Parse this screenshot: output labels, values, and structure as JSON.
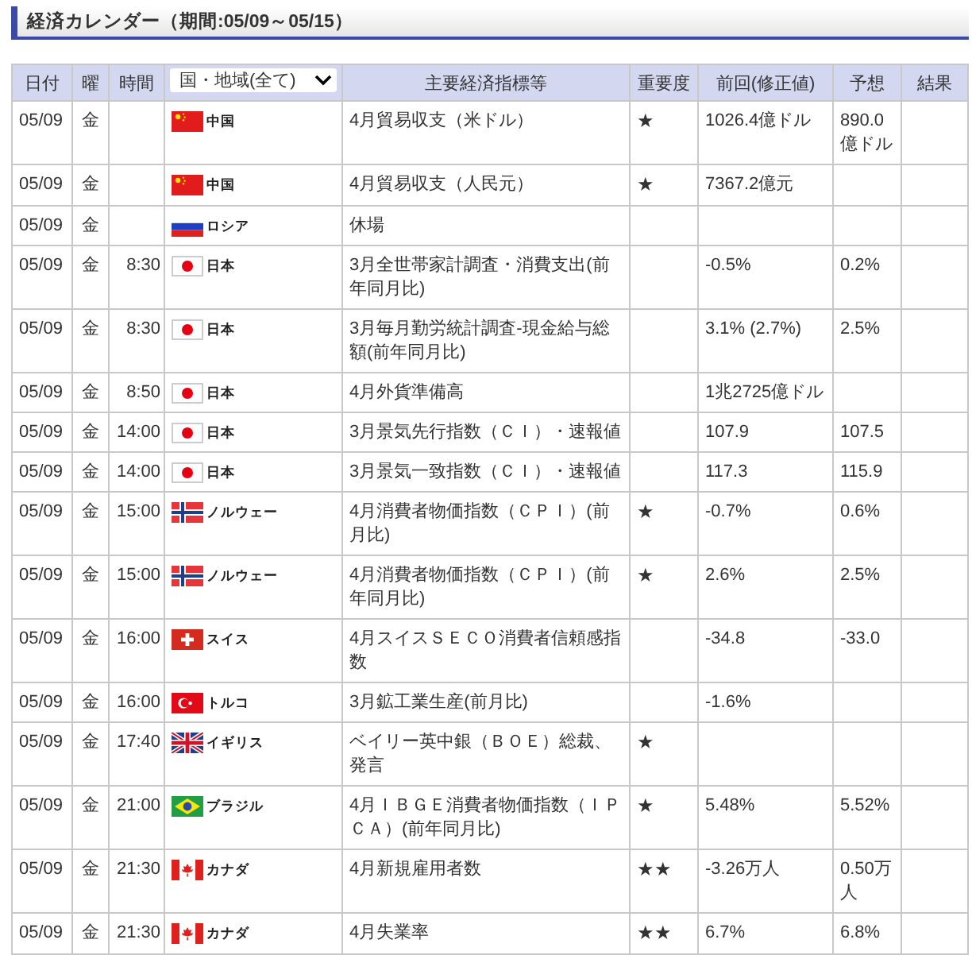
{
  "title": "経済カレンダー（期間:05/09～05/15）",
  "table": {
    "columns": [
      "日付",
      "曜",
      "時間",
      "主要経済指標等",
      "重要度",
      "前回(修正値)",
      "予想",
      "結果"
    ],
    "region_filter": "国・地域(全て)",
    "rows": [
      {
        "date": "05/09",
        "weekday": "金",
        "country": {
          "kind": "cn",
          "name": "中国"
        },
        "indicator": "4月貿易収支（米ドル）",
        "importance": "★",
        "previous": "1026.4億ドル",
        "forecast": "890.0億ドル"
      },
      {
        "date": "05/09",
        "weekday": "金",
        "country": {
          "kind": "cn",
          "name": "中国"
        },
        "indicator": "4月貿易収支（人民元）",
        "importance": "★",
        "previous": "7367.2億元"
      },
      {
        "date": "05/09",
        "weekday": "金",
        "country": {
          "kind": "ru",
          "name": "ロシア"
        },
        "indicator": "休場"
      },
      {
        "date": "05/09",
        "weekday": "金",
        "time": "8:30",
        "country": {
          "kind": "jp",
          "name": "日本"
        },
        "indicator": "3月全世帯家計調査・消費支出(前年同月比)",
        "previous": "-0.5%",
        "forecast": "0.2%"
      },
      {
        "date": "05/09",
        "weekday": "金",
        "time": "8:30",
        "country": {
          "kind": "jp",
          "name": "日本"
        },
        "indicator": "3月毎月勤労統計調査-現金給与総額(前年同月比)",
        "previous": "3.1% (2.7%)",
        "forecast": "2.5%"
      },
      {
        "date": "05/09",
        "weekday": "金",
        "time": "8:50",
        "country": {
          "kind": "jp",
          "name": "日本"
        },
        "indicator": "4月外貨準備高",
        "previous": "1兆2725億ドル"
      },
      {
        "date": "05/09",
        "weekday": "金",
        "time": "14:00",
        "country": {
          "kind": "jp",
          "name": "日本"
        },
        "indicator": "3月景気先行指数（ＣＩ）・速報値",
        "previous": "107.9",
        "forecast": "107.5"
      },
      {
        "date": "05/09",
        "weekday": "金",
        "time": "14:00",
        "country": {
          "kind": "jp",
          "name": "日本"
        },
        "indicator": "3月景気一致指数（ＣＩ）・速報値",
        "previous": "117.3",
        "forecast": "115.9"
      },
      {
        "date": "05/09",
        "weekday": "金",
        "time": "15:00",
        "country": {
          "kind": "no",
          "name": "ノルウェー"
        },
        "indicator": "4月消費者物価指数（ＣＰＩ）(前月比)",
        "importance": "★",
        "previous": "-0.7%",
        "forecast": "0.6%"
      },
      {
        "date": "05/09",
        "weekday": "金",
        "time": "15:00",
        "country": {
          "kind": "no",
          "name": "ノルウェー"
        },
        "indicator": "4月消費者物価指数（ＣＰＩ）(前年同月比)",
        "importance": "★",
        "previous": "2.6%",
        "forecast": "2.5%"
      },
      {
        "date": "05/09",
        "weekday": "金",
        "time": "16:00",
        "country": {
          "kind": "ch",
          "name": "スイス"
        },
        "indicator": "4月スイスＳＥＣＯ消費者信頼感指数",
        "previous": "-34.8",
        "forecast": "-33.0"
      },
      {
        "date": "05/09",
        "weekday": "金",
        "time": "16:00",
        "country": {
          "kind": "tr",
          "name": "トルコ"
        },
        "indicator": "3月鉱工業生産(前月比)",
        "previous": "-1.6%"
      },
      {
        "date": "05/09",
        "weekday": "金",
        "time": "17:40",
        "country": {
          "kind": "gb",
          "name": "イギリス"
        },
        "indicator": " ベイリー英中銀（ＢＯＥ）総裁、発言",
        "importance": "★"
      },
      {
        "date": "05/09",
        "weekday": "金",
        "time": "21:00",
        "country": {
          "kind": "br",
          "name": "ブラジル"
        },
        "indicator": "4月ＩＢＧＥ消費者物価指数（ＩＰＣＡ）(前年同月比)",
        "importance": "★",
        "previous": "5.48%",
        "forecast": "5.52%"
      },
      {
        "date": "05/09",
        "weekday": "金",
        "time": "21:30",
        "country": {
          "kind": "ca",
          "name": "カナダ"
        },
        "indicator": "4月新規雇用者数",
        "importance": "★★",
        "previous": "-3.26万人",
        "forecast": "0.50万人"
      },
      {
        "date": "05/09",
        "weekday": "金",
        "time": "21:30",
        "country": {
          "kind": "ca",
          "name": "カナダ"
        },
        "indicator": "4月失業率",
        "importance": "★★",
        "previous": "6.7%",
        "forecast": "6.8%"
      }
    ]
  }
}
